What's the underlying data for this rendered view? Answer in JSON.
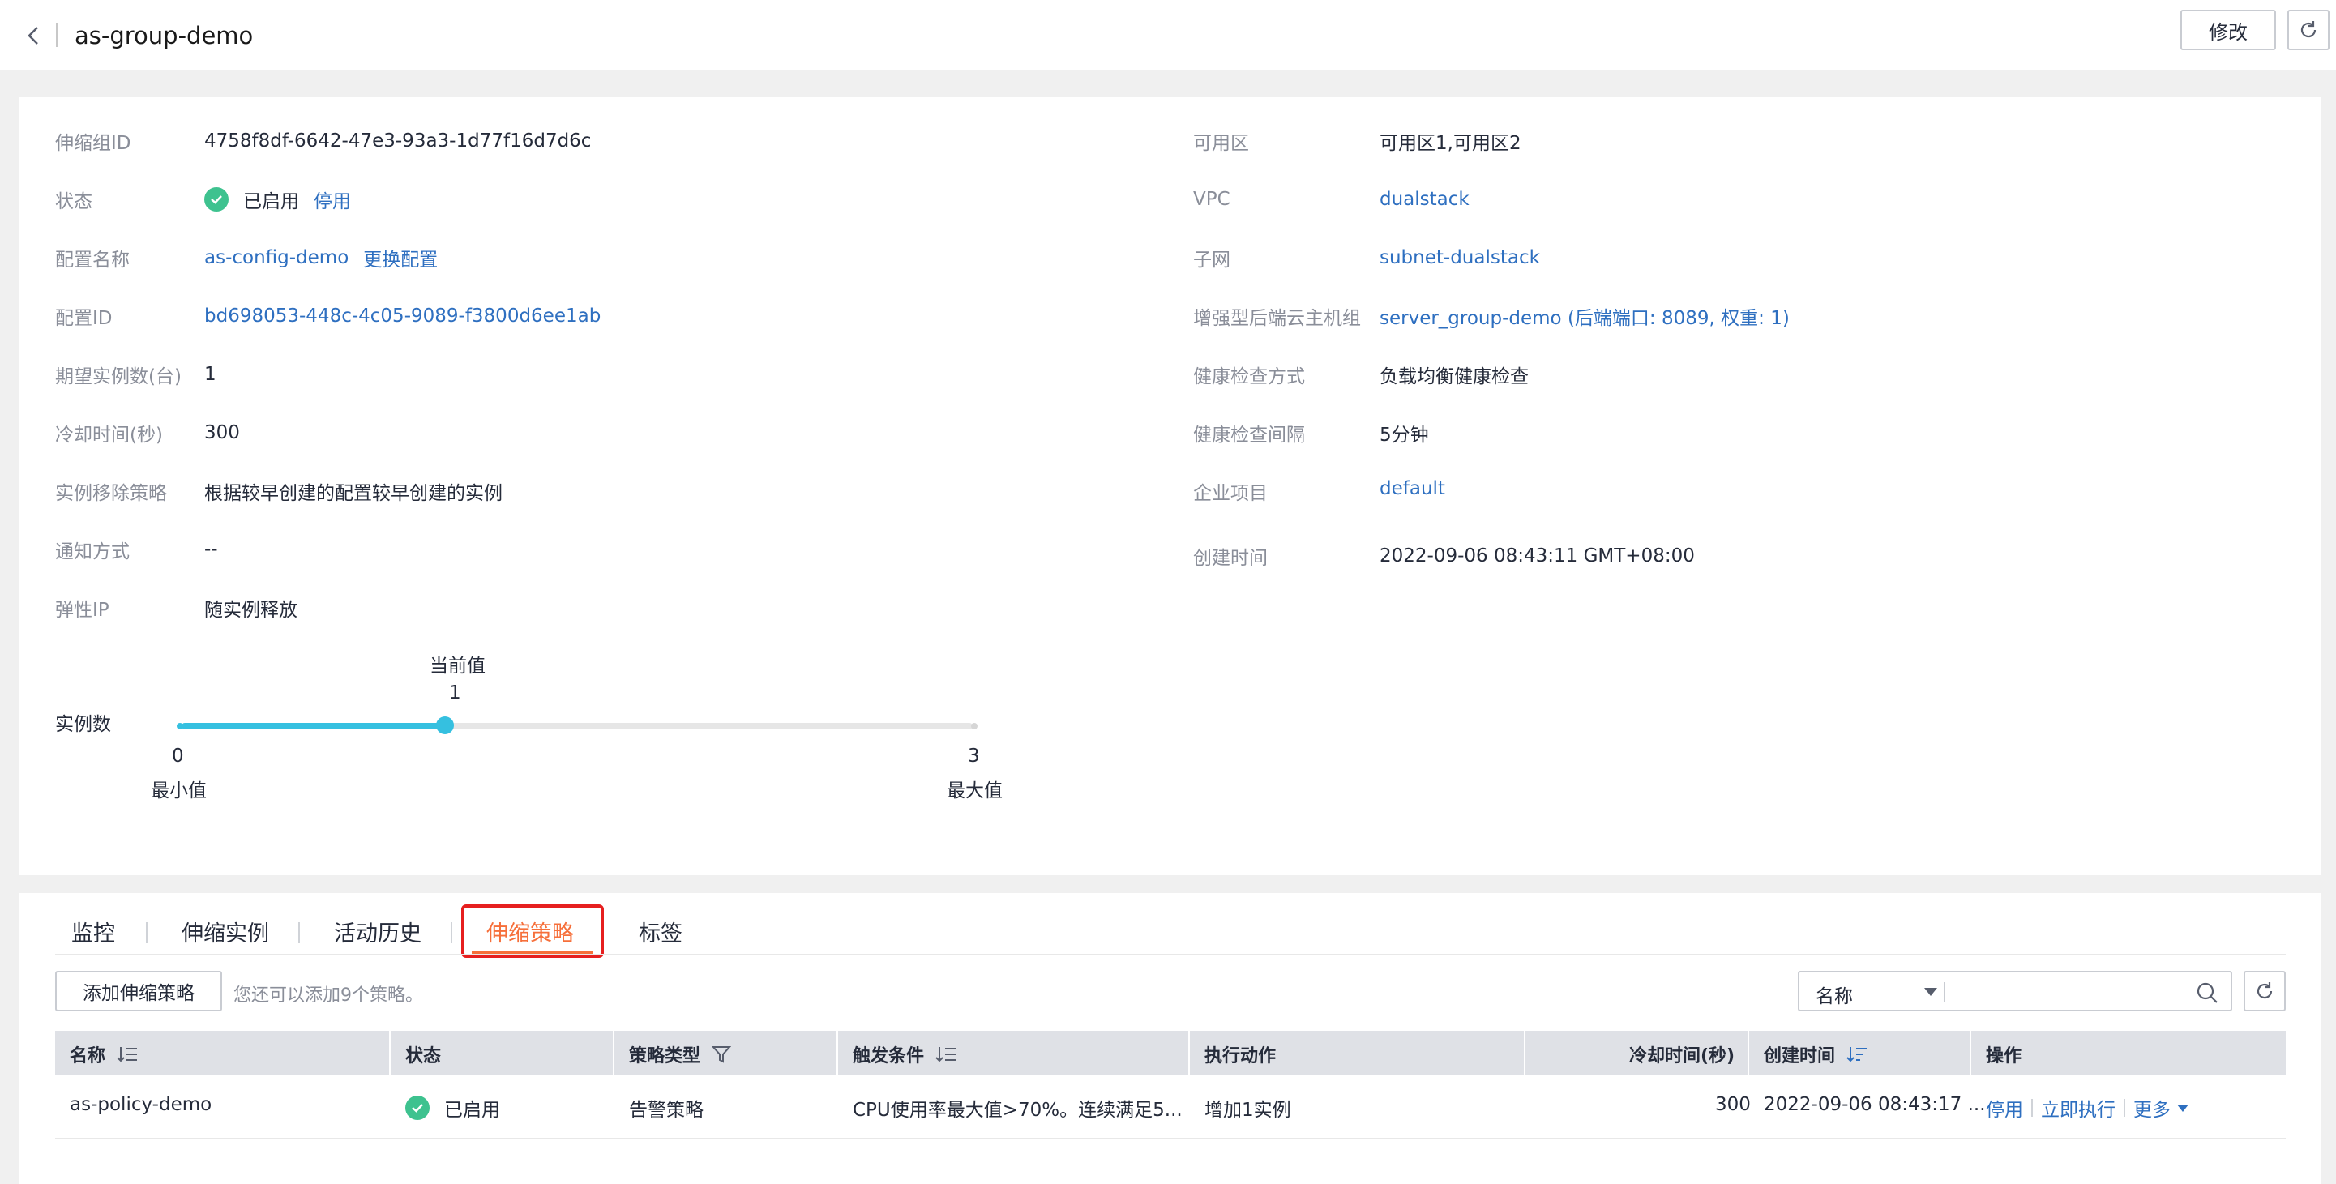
{
  "header": {
    "title": "as-group-demo",
    "edit_label": "修改"
  },
  "info": {
    "left": [
      {
        "label": "伸缩组ID",
        "value": "4758f8df-6642-47e3-93a3-1d77f16d7d6c"
      },
      {
        "label": "状态",
        "value": "已启用",
        "action": "停用"
      },
      {
        "label": "配置名称",
        "value": "as-config-demo",
        "action": "更换配置"
      },
      {
        "label": "配置ID",
        "value": "bd698053-448c-4c05-9089-f3800d6ee1ab"
      },
      {
        "label": "期望实例数(台)",
        "value": "1"
      },
      {
        "label": "冷却时间(秒)",
        "value": "300"
      },
      {
        "label": "实例移除策略",
        "value": "根据较早创建的配置较早创建的实例"
      },
      {
        "label": "通知方式",
        "value": "--"
      },
      {
        "label": "弹性IP",
        "value": "随实例释放"
      }
    ],
    "right": [
      {
        "label": "可用区",
        "value": "可用区1,可用区2"
      },
      {
        "label": "VPC",
        "value": "dualstack"
      },
      {
        "label": "子网",
        "value": "subnet-dualstack"
      },
      {
        "label": "增强型后端云主机组",
        "value": "server_group-demo (后端端口: 8089, 权重: 1)"
      },
      {
        "label": "健康检查方式",
        "value": "负载均衡健康检查"
      },
      {
        "label": "健康检查间隔",
        "value": "5分钟"
      },
      {
        "label": "企业项目",
        "value": "default"
      },
      {
        "label": "创建时间",
        "value": "2022-09-06 08:43:11 GMT+08:00"
      }
    ]
  },
  "instances": {
    "label": "实例数",
    "current_label": "当前值",
    "current": "1",
    "min": "0",
    "min_label": "最小值",
    "max": "3",
    "max_label": "最大值",
    "current_fraction": 0.3333
  },
  "tabs": [
    {
      "label": "监控"
    },
    {
      "label": "伸缩实例"
    },
    {
      "label": "活动历史"
    },
    {
      "label": "伸缩策略"
    },
    {
      "label": "标签"
    }
  ],
  "policies": {
    "add_label": "添加伸缩策略",
    "hint": "您还可以添加9个策略。",
    "filter_select": "名称",
    "filter_placeholder": "",
    "columns": [
      "名称",
      "状态",
      "策略类型",
      "触发条件",
      "执行动作",
      "冷却时间(秒)",
      "创建时间",
      "操作"
    ],
    "rows": [
      {
        "name": "as-policy-demo",
        "status": "已启用",
        "type": "告警策略",
        "condition": "CPU使用率最大值>70%。连续满足5...",
        "action": "增加1实例",
        "cooldown": "300",
        "created": "2022-09-06 08:43:17 ...",
        "ops": [
          "停用",
          "立即执行",
          "更多"
        ]
      }
    ]
  },
  "colors": {
    "accent": "#f66f3a",
    "link": "#2e6fc0",
    "success": "#3ec28f",
    "slider": "#35c0e0",
    "highlight": "#e61f1f"
  }
}
